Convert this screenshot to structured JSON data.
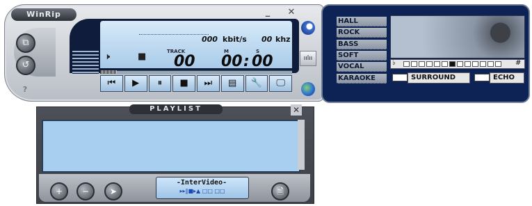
{
  "app": {
    "name": "WinRip"
  },
  "window": {
    "minimize": "_",
    "close": "✕"
  },
  "display": {
    "bitrate": "000",
    "bitrate_unit": "kbit/s",
    "freq": "00",
    "freq_unit": "khz",
    "track_label": "TRACK",
    "track": "00",
    "min_label": "M",
    "min": "00",
    "sec_label": "S",
    "sec": "00",
    "mute_icon": "🕨",
    "stop_icon": "■"
  },
  "transport": [
    "⏮",
    "▶",
    "⏸",
    "■",
    "⏭",
    "▤",
    "🔧",
    "🖵"
  ],
  "side_buttons": {
    "a": "⧉",
    "b": "↺",
    "help": "?"
  },
  "effects": {
    "labels": [
      "HALL",
      "ROCK",
      "BASS",
      "SOFT",
      "VOCAL",
      "KARAOKE"
    ],
    "flat": "♭",
    "sharp": "#",
    "pitch_index": 6,
    "surround": "SURROUND",
    "echo": "ECHO"
  },
  "playlist": {
    "title": "PLAYLIST",
    "close": "✕",
    "logo": "-InterVideo-",
    "logo_sub": "▸▸‖■▸▲ □□ □□",
    "add": "+",
    "remove": "−",
    "select": "➤",
    "doc": "🗎"
  },
  "colors": {
    "lcd": "#b6d4ef",
    "panel": "#0e2355"
  }
}
